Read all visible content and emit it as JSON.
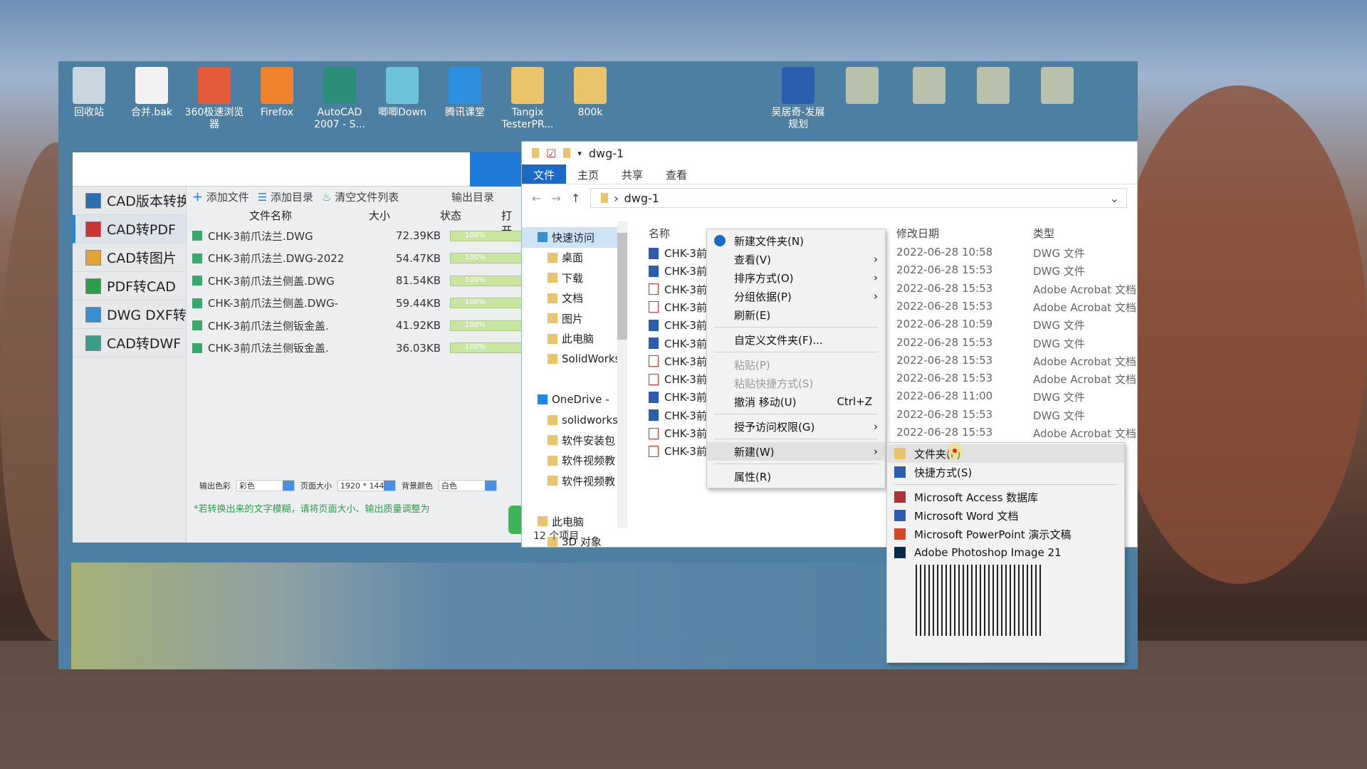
{
  "desktop": {
    "icons": [
      {
        "label": "回收站",
        "color": "#c9d6df"
      },
      {
        "label": "合并.bak",
        "color": "#f2f2f2"
      },
      {
        "label": "360极速浏览器",
        "color": "#e55b3a"
      },
      {
        "label": "Firefox",
        "color": "#f0812d"
      },
      {
        "label": "AutoCAD 2007 - S...",
        "color": "#2b8c7a"
      },
      {
        "label": "唧唧Down",
        "color": "#6fc3d8"
      },
      {
        "label": "腾讯课堂",
        "color": "#2d8fe0"
      },
      {
        "label": "Tangix TesterPR...",
        "color": "#e9c46a"
      },
      {
        "label": "800k",
        "color": "#e9c46a"
      },
      {
        "label": "吴居奇-发展规划",
        "color": "#2b5fad"
      }
    ]
  },
  "cad_app": {
    "sidebar": [
      {
        "label": "CAD版本转换"
      },
      {
        "label": "CAD转PDF",
        "active": true
      },
      {
        "label": "CAD转图片"
      },
      {
        "label": "PDF转CAD"
      },
      {
        "label": "DWG DXF转换"
      },
      {
        "label": "CAD转DWF"
      }
    ],
    "toolbar": {
      "add_file": "添加文件",
      "add_dir": "添加目录",
      "clear": "清空文件列表",
      "output_dir": "输出目录"
    },
    "columns": {
      "name": "文件名称",
      "size": "大小",
      "status": "状态",
      "open": "打开"
    },
    "files": [
      {
        "name": "CHK-3前爪法兰.DWG",
        "size": "72.39KB",
        "progress": "100%"
      },
      {
        "name": "CHK-3前爪法兰.DWG-2022",
        "size": "54.47KB",
        "progress": "100%"
      },
      {
        "name": "CHK-3前爪法兰侧盖.DWG",
        "size": "81.54KB",
        "progress": "100%"
      },
      {
        "name": "CHK-3前爪法兰侧盖.DWG-",
        "size": "59.44KB",
        "progress": "100%"
      },
      {
        "name": "CHK-3前爪法兰侧钣金盖.",
        "size": "41.92KB",
        "progress": "100%"
      },
      {
        "name": "CHK-3前爪法兰侧钣金盖.",
        "size": "36.03KB",
        "progress": "100%"
      }
    ],
    "options": {
      "color_label": "输出色彩",
      "color_value": "彩色",
      "page_label": "页面大小",
      "page_value": "1920 * 1440",
      "bg_label": "背景颜色",
      "bg_value": "白色"
    },
    "hint": "*若转换出来的文字模糊，请将页面大小、输出质量调整为"
  },
  "explorer": {
    "title": "dwg-1",
    "ribbon": [
      "文件",
      "主页",
      "共享",
      "查看"
    ],
    "path": "dwg-1",
    "nav": [
      "快速访问",
      "桌面",
      "下载",
      "文档",
      "图片",
      "此电脑",
      "SolidWorks",
      "",
      "OneDrive -",
      "solidworks",
      "软件安装包",
      "软件视频教",
      "软件视频教",
      "",
      "此电脑",
      "3D 对象"
    ],
    "columns": {
      "name": "名称",
      "date": "修改日期",
      "type": "类型"
    },
    "files": [
      {
        "name": "CHK-3前",
        "date": "2022-06-28 10:58",
        "type": "DWG 文件",
        "kind": "dwg"
      },
      {
        "name": "CHK-3前",
        "date": "2022-06-28 15:53",
        "type": "DWG 文件",
        "kind": "dwg"
      },
      {
        "name": "CHK-3前",
        "date": "2022-06-28 15:53",
        "type": "Adobe Acrobat 文档",
        "kind": "pdf"
      },
      {
        "name": "CHK-3前",
        "date": "2022-06-28 15:53",
        "type": "Adobe Acrobat 文档",
        "kind": "pdf"
      },
      {
        "name": "CHK-3前",
        "date": "2022-06-28 10:59",
        "type": "DWG 文件",
        "kind": "dwg"
      },
      {
        "name": "CHK-3前",
        "date": "2022-06-28 15:53",
        "type": "DWG 文件",
        "kind": "dwg"
      },
      {
        "name": "CHK-3前",
        "date": "2022-06-28 15:53",
        "type": "Adobe Acrobat 文档",
        "kind": "pdf"
      },
      {
        "name": "CHK-3前",
        "date": "2022-06-28 15:53",
        "type": "Adobe Acrobat 文档",
        "kind": "pdf"
      },
      {
        "name": "CHK-3前",
        "date": "2022-06-28 11:00",
        "type": "DWG 文件",
        "kind": "dwg"
      },
      {
        "name": "CHK-3前",
        "date": "2022-06-28 15:53",
        "type": "DWG 文件",
        "kind": "dwg"
      },
      {
        "name": "CHK-3前",
        "date": "2022-06-28 15:53",
        "type": "Adobe Acrobat 文档",
        "kind": "pdf"
      },
      {
        "name": "CHK-3前",
        "date": "",
        "type": "",
        "kind": "pdf"
      }
    ],
    "status": "12 个项目"
  },
  "context_menu": {
    "items": [
      {
        "label": "新建文件夹(N)",
        "icon": "new-folder-icon"
      },
      {
        "label": "查看(V)",
        "sub": true
      },
      {
        "label": "排序方式(O)",
        "sub": true
      },
      {
        "label": "分组依据(P)",
        "sub": true
      },
      {
        "label": "刷新(E)"
      },
      {
        "sep": true
      },
      {
        "label": "自定义文件夹(F)..."
      },
      {
        "sep": true
      },
      {
        "label": "粘贴(P)",
        "disabled": true
      },
      {
        "label": "粘贴快捷方式(S)",
        "disabled": true
      },
      {
        "label": "撤消 移动(U)",
        "shortcut": "Ctrl+Z"
      },
      {
        "sep": true
      },
      {
        "label": "授予访问权限(G)",
        "sub": true
      },
      {
        "sep": true
      },
      {
        "label": "新建(W)",
        "sub": true,
        "highlight": true
      },
      {
        "sep": true
      },
      {
        "label": "属性(R)"
      }
    ]
  },
  "new_submenu": {
    "items": [
      {
        "label": "文件夹(F)",
        "icon": "folder-icon",
        "highlight": true
      },
      {
        "label": "快捷方式(S)",
        "icon": "shortcut-icon"
      },
      {
        "sep": true
      },
      {
        "label": "Microsoft Access 数据库",
        "icon": "access-icon"
      },
      {
        "label": "Microsoft Word 文档",
        "icon": "word-icon"
      },
      {
        "label": "Microsoft PowerPoint 演示文稿",
        "icon": "powerpoint-icon"
      },
      {
        "label": "Adobe Photoshop Image 21",
        "icon": "photoshop-icon"
      }
    ]
  }
}
